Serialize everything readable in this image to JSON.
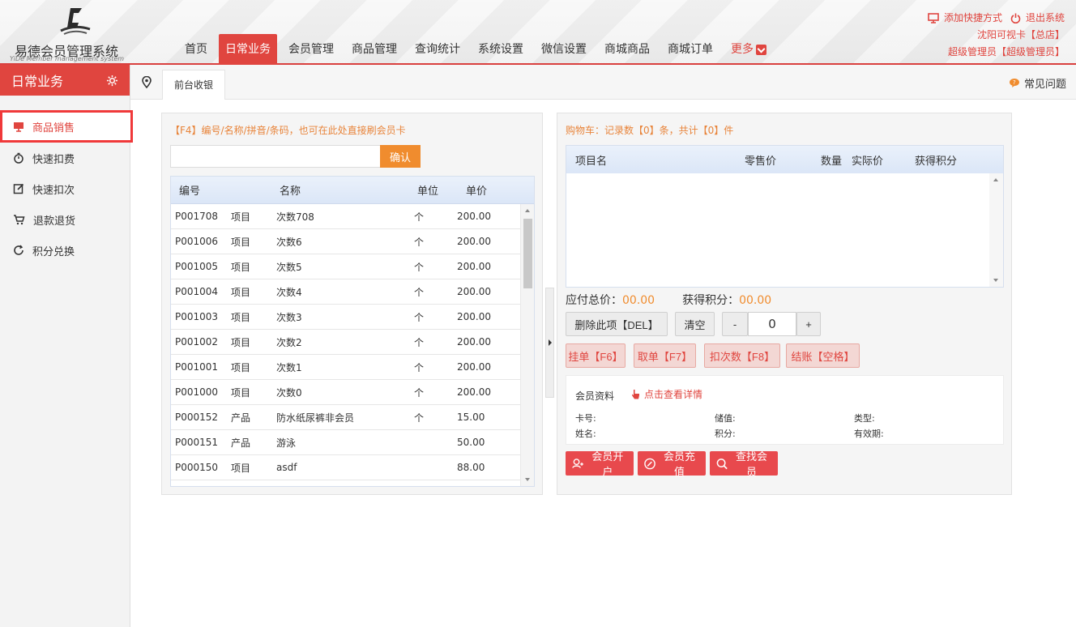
{
  "app": {
    "title": "易德会员管理系统",
    "subtitle": "YiDe Member management system"
  },
  "nav": {
    "items": [
      "首页",
      "日常业务",
      "会员管理",
      "商品管理",
      "查询统计",
      "系统设置",
      "微信设置",
      "商城商品",
      "商城订单"
    ],
    "active": "日常业务",
    "more": "更多"
  },
  "top": {
    "add_shortcut": "添加快捷方式",
    "logout": "退出系统",
    "store": "沈阳可视卡【总店】",
    "user": "超级管理员【超级管理员】"
  },
  "sidebar": {
    "title": "日常业务",
    "items": [
      {
        "label": "商品销售",
        "icon": "monitor-icon"
      },
      {
        "label": "快速扣费",
        "icon": "stopwatch-icon"
      },
      {
        "label": "快速扣次",
        "icon": "edit-icon"
      },
      {
        "label": "退款退货",
        "icon": "cart-return-icon"
      },
      {
        "label": "积分兑换",
        "icon": "refresh-icon"
      }
    ]
  },
  "tabbar": {
    "tab": "前台收银",
    "faq": "常见问题"
  },
  "search": {
    "hint": "【F4】编号/名称/拼音/条码，也可在此处直接刷会员卡",
    "confirm": "确认",
    "value": ""
  },
  "products": {
    "headers": [
      "编号",
      "名称",
      "单位",
      "单价"
    ],
    "rows": [
      [
        "P001708",
        "项目",
        "次数708",
        "个",
        "200.00"
      ],
      [
        "P001006",
        "项目",
        "次数6",
        "个",
        "200.00"
      ],
      [
        "P001005",
        "项目",
        "次数5",
        "个",
        "200.00"
      ],
      [
        "P001004",
        "项目",
        "次数4",
        "个",
        "200.00"
      ],
      [
        "P001003",
        "项目",
        "次数3",
        "个",
        "200.00"
      ],
      [
        "P001002",
        "项目",
        "次数2",
        "个",
        "200.00"
      ],
      [
        "P001001",
        "项目",
        "次数1",
        "个",
        "200.00"
      ],
      [
        "P001000",
        "项目",
        "次数0",
        "个",
        "200.00"
      ],
      [
        "P000152",
        "产品",
        "防水纸尿裤非会员",
        "个",
        "15.00"
      ],
      [
        "P000151",
        "产品",
        "游泳",
        "",
        "50.00"
      ],
      [
        "P000150",
        "项目",
        "asdf",
        "",
        "88.00"
      ]
    ]
  },
  "cart": {
    "title": "购物车：记录数【0】条，共计【0】件",
    "headers": [
      "项目名",
      "零售价",
      "数量",
      "实际价",
      "获得积分"
    ],
    "total_label": "应付总价：",
    "total_value": "00.00",
    "points_label": "获得积分：",
    "points_value": "00.00",
    "delete_btn": "删除此项【DEL】",
    "clear_btn": "清空",
    "minus": "-",
    "qty": "0",
    "plus": "+",
    "hold_btn": "挂单【F6】",
    "take_btn": "取单【F7】",
    "deduct_btn": "扣次数【F8】",
    "checkout_btn": "结账【空格】"
  },
  "member": {
    "title": "会员资料",
    "detail_link": "点击查看详情",
    "fields": [
      "卡号:",
      "储值:",
      "类型:",
      "姓名:",
      "积分:",
      "有效期:"
    ],
    "open_btn": "会员开户",
    "recharge_btn": "会员充值",
    "find_btn": "查找会员"
  },
  "colors": {
    "accent": "#e0453f",
    "orange": "#f08c2e",
    "highlight_border": "#f0393a"
  }
}
